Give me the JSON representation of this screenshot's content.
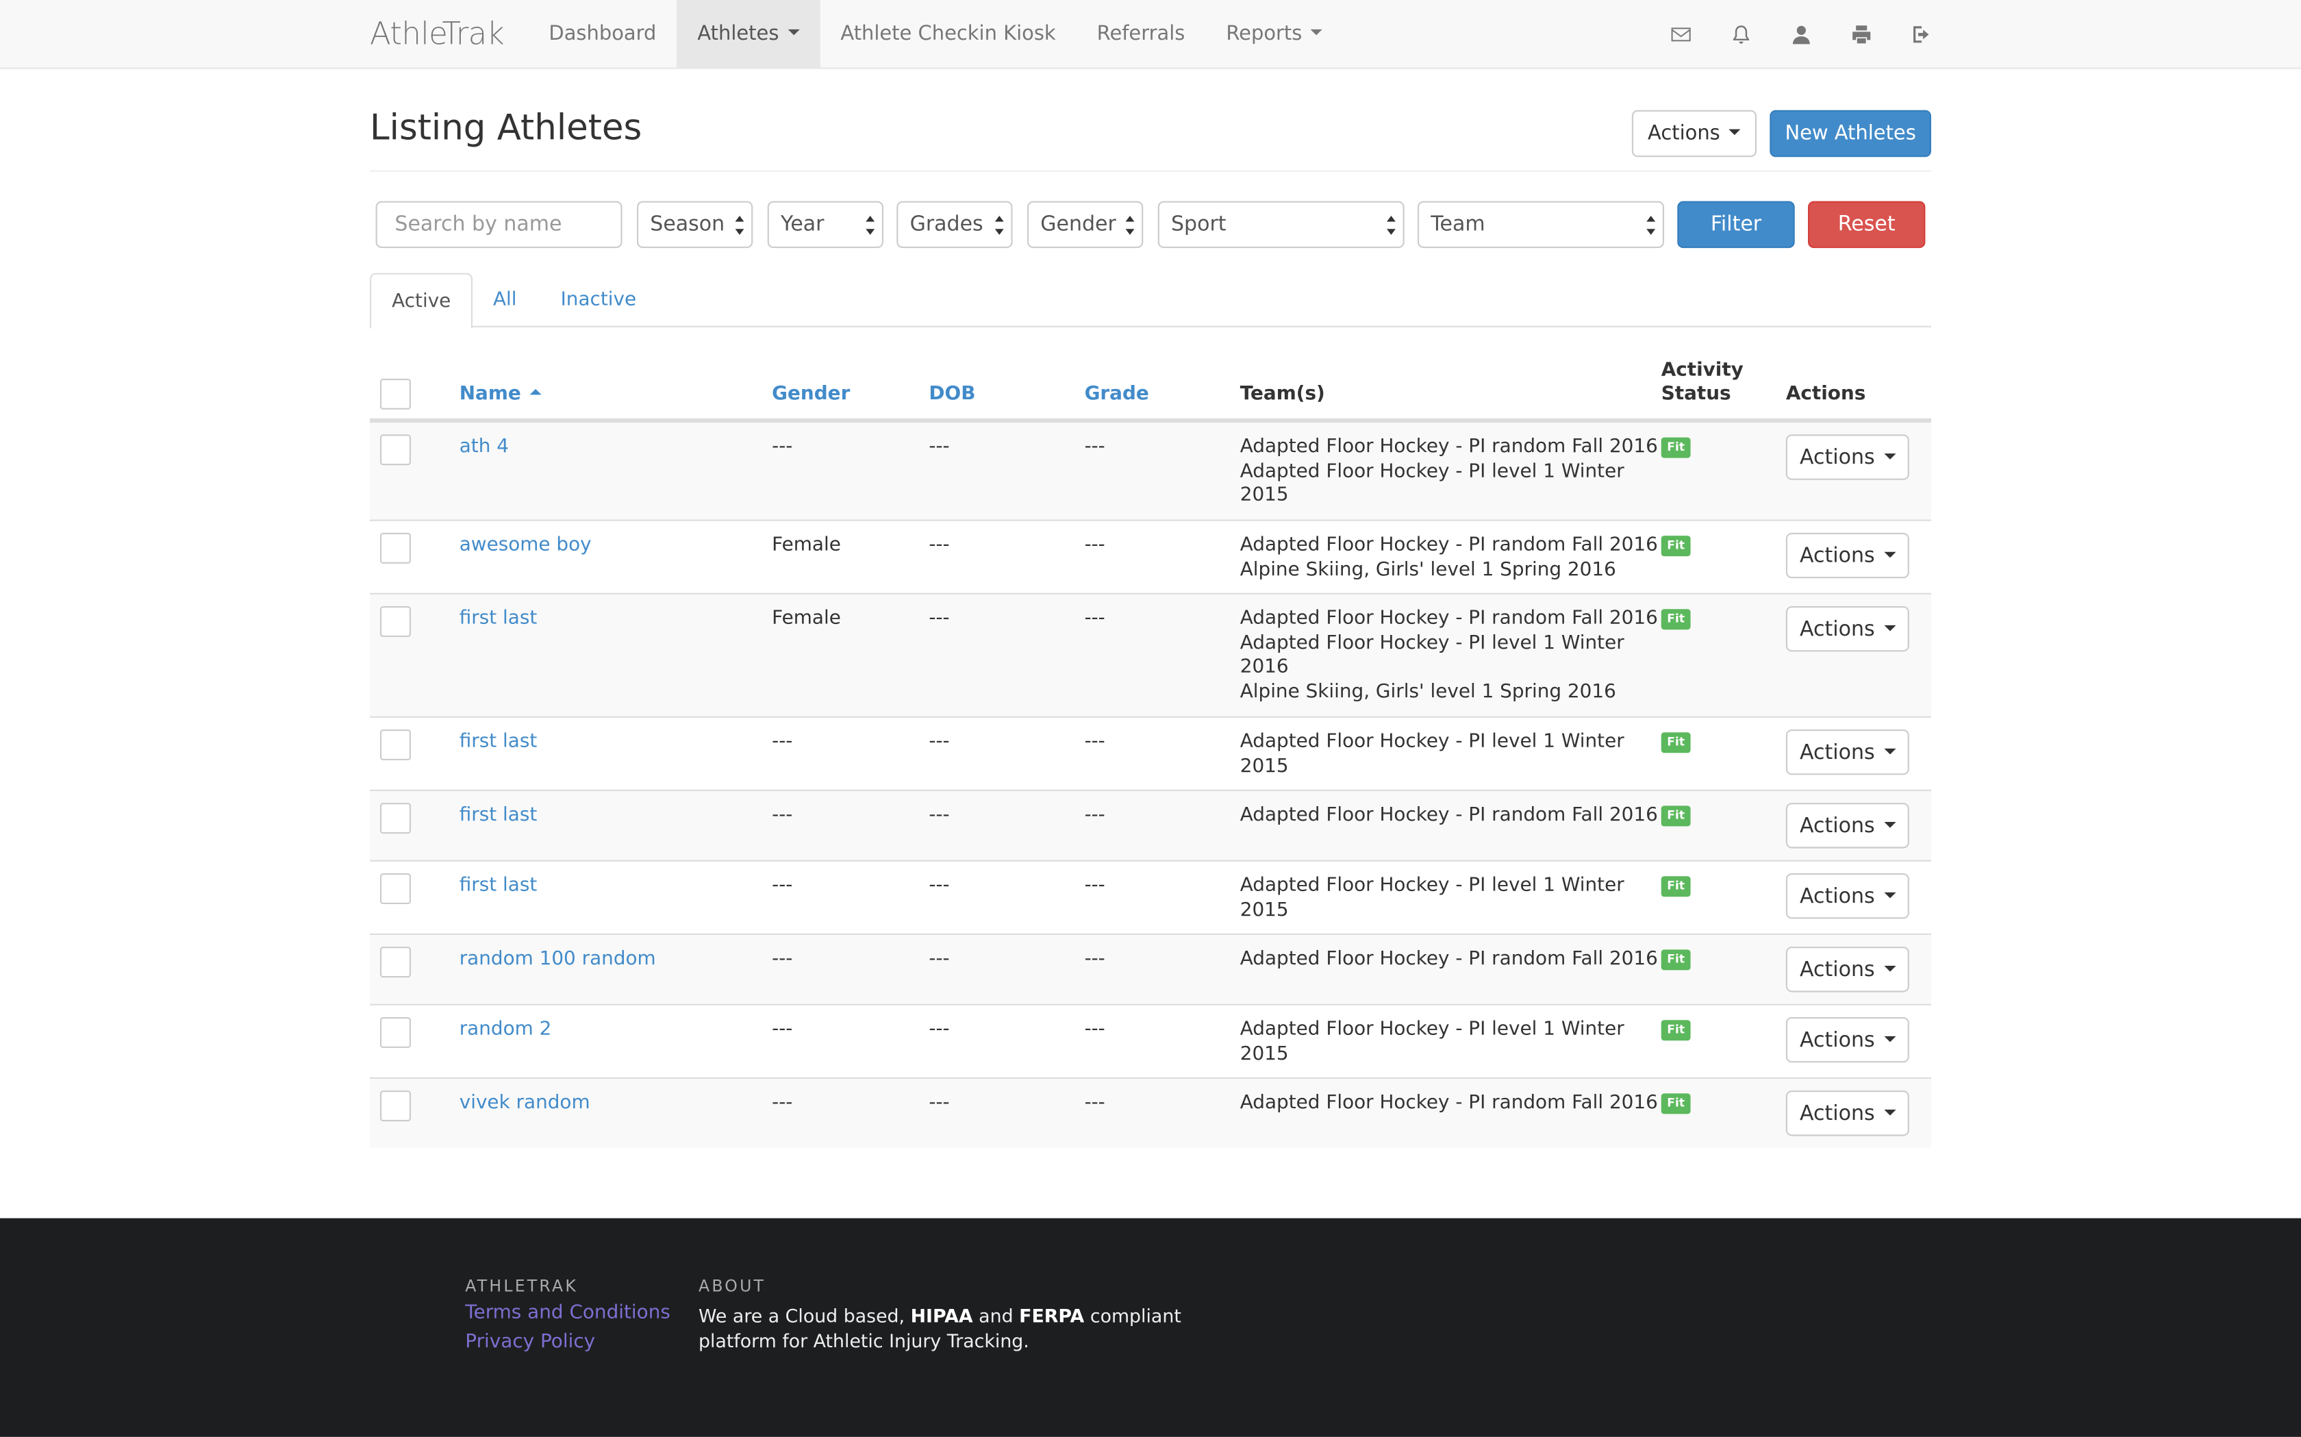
{
  "nav": {
    "brand": "AthleTrak",
    "items": [
      {
        "label": "Dashboard",
        "dropdown": false,
        "active": false
      },
      {
        "label": "Athletes",
        "dropdown": true,
        "active": true
      },
      {
        "label": "Athlete Checkin Kiosk",
        "dropdown": false,
        "active": false
      },
      {
        "label": "Referrals",
        "dropdown": false,
        "active": false
      },
      {
        "label": "Reports",
        "dropdown": true,
        "active": false
      }
    ],
    "icons": [
      "envelope-icon",
      "bell-icon",
      "user-icon",
      "print-icon",
      "logout-icon"
    ]
  },
  "header": {
    "title": "Listing Athletes",
    "actions_label": "Actions",
    "new_label": "New Athletes"
  },
  "filters": {
    "search_placeholder": "Search by name",
    "season": "Season",
    "year": "Year",
    "grades": "Grades",
    "gender": "Gender",
    "sport": "Sport",
    "team": "Team",
    "filter_label": "Filter",
    "reset_label": "Reset"
  },
  "tabs": {
    "active": "Active",
    "all": "All",
    "inactive": "Inactive"
  },
  "table": {
    "headers": {
      "name": "Name",
      "gender": "Gender",
      "dob": "DOB",
      "grade": "Grade",
      "teams": "Team(s)",
      "activity_line1": "Activity",
      "activity_line2": "Status",
      "actions": "Actions"
    },
    "rows": [
      {
        "name": "ath 4",
        "gender": "---",
        "dob": "---",
        "grade": "---",
        "teams": [
          "Adapted Floor Hockey - PI random Fall 2016",
          "Adapted Floor Hockey - PI level 1 Winter",
          "2015"
        ],
        "status": "Fit",
        "actions": "Actions"
      },
      {
        "name": "awesome boy",
        "gender": "Female",
        "dob": "---",
        "grade": "---",
        "teams": [
          "Adapted Floor Hockey - PI random Fall 2016",
          "Alpine Skiing, Girls' level 1 Spring 2016"
        ],
        "status": "Fit",
        "actions": "Actions"
      },
      {
        "name": "first last",
        "gender": "Female",
        "dob": "---",
        "grade": "---",
        "teams": [
          "Adapted Floor Hockey - PI random Fall 2016",
          "Adapted Floor Hockey - PI level 1 Winter",
          "2016",
          "Alpine Skiing, Girls' level 1 Spring 2016"
        ],
        "status": "Fit",
        "actions": "Actions"
      },
      {
        "name": "first last",
        "gender": "---",
        "dob": "---",
        "grade": "---",
        "teams": [
          "Adapted Floor Hockey - PI level 1 Winter",
          "2015"
        ],
        "status": "Fit",
        "actions": "Actions"
      },
      {
        "name": "first last",
        "gender": "---",
        "dob": "---",
        "grade": "---",
        "teams": [
          "Adapted Floor Hockey - PI random Fall 2016"
        ],
        "status": "Fit",
        "actions": "Actions"
      },
      {
        "name": "first last",
        "gender": "---",
        "dob": "---",
        "grade": "---",
        "teams": [
          "Adapted Floor Hockey - PI level 1 Winter",
          "2015"
        ],
        "status": "Fit",
        "actions": "Actions"
      },
      {
        "name": "random 100 random",
        "gender": "---",
        "dob": "---",
        "grade": "---",
        "teams": [
          "Adapted Floor Hockey - PI random Fall 2016"
        ],
        "status": "Fit",
        "actions": "Actions"
      },
      {
        "name": "random 2",
        "gender": "---",
        "dob": "---",
        "grade": "---",
        "teams": [
          "Adapted Floor Hockey - PI level 1 Winter",
          "2015"
        ],
        "status": "Fit",
        "actions": "Actions"
      },
      {
        "name": "vivek random",
        "gender": "---",
        "dob": "---",
        "grade": "---",
        "teams": [
          "Adapted Floor Hockey - PI random Fall 2016"
        ],
        "status": "Fit",
        "actions": "Actions"
      }
    ]
  },
  "footer": {
    "athletrak_heading": "ATHLETRAK",
    "terms": "Terms and Conditions",
    "privacy": "Privacy Policy",
    "about_heading": "ABOUT",
    "about_pre": "We are a Cloud based,",
    "about_hipaa": "HIPAA",
    "about_and": "and",
    "about_ferpa": "FERPA",
    "about_post": "compliant platform for Athletic Injury Tracking."
  },
  "colors": {
    "primary": "#428bca",
    "danger": "#d9534f",
    "success": "#5cb85c",
    "footer_bg": "#1d1e20",
    "footer_link": "#7d6fd1"
  }
}
